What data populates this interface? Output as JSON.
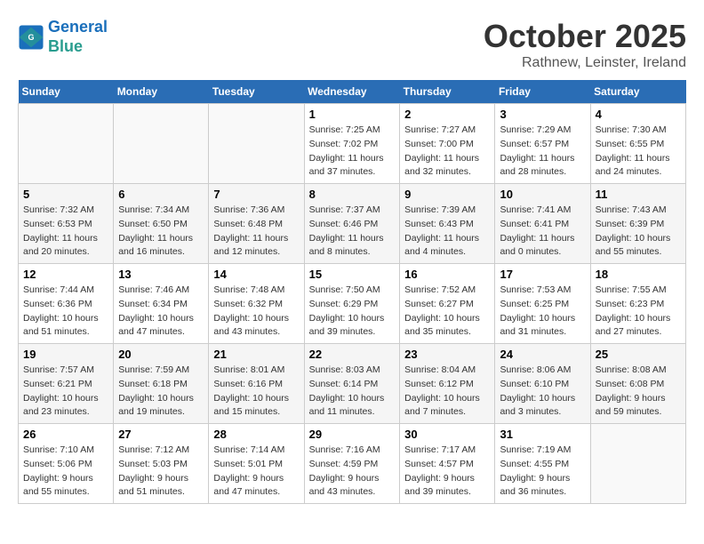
{
  "logo": {
    "line1": "General",
    "line2": "Blue"
  },
  "title": "October 2025",
  "subtitle": "Rathnew, Leinster, Ireland",
  "days_of_week": [
    "Sunday",
    "Monday",
    "Tuesday",
    "Wednesday",
    "Thursday",
    "Friday",
    "Saturday"
  ],
  "weeks": [
    [
      {
        "day": "",
        "sunrise": "",
        "sunset": "",
        "daylight": ""
      },
      {
        "day": "",
        "sunrise": "",
        "sunset": "",
        "daylight": ""
      },
      {
        "day": "",
        "sunrise": "",
        "sunset": "",
        "daylight": ""
      },
      {
        "day": "1",
        "sunrise": "Sunrise: 7:25 AM",
        "sunset": "Sunset: 7:02 PM",
        "daylight": "Daylight: 11 hours and 37 minutes."
      },
      {
        "day": "2",
        "sunrise": "Sunrise: 7:27 AM",
        "sunset": "Sunset: 7:00 PM",
        "daylight": "Daylight: 11 hours and 32 minutes."
      },
      {
        "day": "3",
        "sunrise": "Sunrise: 7:29 AM",
        "sunset": "Sunset: 6:57 PM",
        "daylight": "Daylight: 11 hours and 28 minutes."
      },
      {
        "day": "4",
        "sunrise": "Sunrise: 7:30 AM",
        "sunset": "Sunset: 6:55 PM",
        "daylight": "Daylight: 11 hours and 24 minutes."
      }
    ],
    [
      {
        "day": "5",
        "sunrise": "Sunrise: 7:32 AM",
        "sunset": "Sunset: 6:53 PM",
        "daylight": "Daylight: 11 hours and 20 minutes."
      },
      {
        "day": "6",
        "sunrise": "Sunrise: 7:34 AM",
        "sunset": "Sunset: 6:50 PM",
        "daylight": "Daylight: 11 hours and 16 minutes."
      },
      {
        "day": "7",
        "sunrise": "Sunrise: 7:36 AM",
        "sunset": "Sunset: 6:48 PM",
        "daylight": "Daylight: 11 hours and 12 minutes."
      },
      {
        "day": "8",
        "sunrise": "Sunrise: 7:37 AM",
        "sunset": "Sunset: 6:46 PM",
        "daylight": "Daylight: 11 hours and 8 minutes."
      },
      {
        "day": "9",
        "sunrise": "Sunrise: 7:39 AM",
        "sunset": "Sunset: 6:43 PM",
        "daylight": "Daylight: 11 hours and 4 minutes."
      },
      {
        "day": "10",
        "sunrise": "Sunrise: 7:41 AM",
        "sunset": "Sunset: 6:41 PM",
        "daylight": "Daylight: 11 hours and 0 minutes."
      },
      {
        "day": "11",
        "sunrise": "Sunrise: 7:43 AM",
        "sunset": "Sunset: 6:39 PM",
        "daylight": "Daylight: 10 hours and 55 minutes."
      }
    ],
    [
      {
        "day": "12",
        "sunrise": "Sunrise: 7:44 AM",
        "sunset": "Sunset: 6:36 PM",
        "daylight": "Daylight: 10 hours and 51 minutes."
      },
      {
        "day": "13",
        "sunrise": "Sunrise: 7:46 AM",
        "sunset": "Sunset: 6:34 PM",
        "daylight": "Daylight: 10 hours and 47 minutes."
      },
      {
        "day": "14",
        "sunrise": "Sunrise: 7:48 AM",
        "sunset": "Sunset: 6:32 PM",
        "daylight": "Daylight: 10 hours and 43 minutes."
      },
      {
        "day": "15",
        "sunrise": "Sunrise: 7:50 AM",
        "sunset": "Sunset: 6:29 PM",
        "daylight": "Daylight: 10 hours and 39 minutes."
      },
      {
        "day": "16",
        "sunrise": "Sunrise: 7:52 AM",
        "sunset": "Sunset: 6:27 PM",
        "daylight": "Daylight: 10 hours and 35 minutes."
      },
      {
        "day": "17",
        "sunrise": "Sunrise: 7:53 AM",
        "sunset": "Sunset: 6:25 PM",
        "daylight": "Daylight: 10 hours and 31 minutes."
      },
      {
        "day": "18",
        "sunrise": "Sunrise: 7:55 AM",
        "sunset": "Sunset: 6:23 PM",
        "daylight": "Daylight: 10 hours and 27 minutes."
      }
    ],
    [
      {
        "day": "19",
        "sunrise": "Sunrise: 7:57 AM",
        "sunset": "Sunset: 6:21 PM",
        "daylight": "Daylight: 10 hours and 23 minutes."
      },
      {
        "day": "20",
        "sunrise": "Sunrise: 7:59 AM",
        "sunset": "Sunset: 6:18 PM",
        "daylight": "Daylight: 10 hours and 19 minutes."
      },
      {
        "day": "21",
        "sunrise": "Sunrise: 8:01 AM",
        "sunset": "Sunset: 6:16 PM",
        "daylight": "Daylight: 10 hours and 15 minutes."
      },
      {
        "day": "22",
        "sunrise": "Sunrise: 8:03 AM",
        "sunset": "Sunset: 6:14 PM",
        "daylight": "Daylight: 10 hours and 11 minutes."
      },
      {
        "day": "23",
        "sunrise": "Sunrise: 8:04 AM",
        "sunset": "Sunset: 6:12 PM",
        "daylight": "Daylight: 10 hours and 7 minutes."
      },
      {
        "day": "24",
        "sunrise": "Sunrise: 8:06 AM",
        "sunset": "Sunset: 6:10 PM",
        "daylight": "Daylight: 10 hours and 3 minutes."
      },
      {
        "day": "25",
        "sunrise": "Sunrise: 8:08 AM",
        "sunset": "Sunset: 6:08 PM",
        "daylight": "Daylight: 9 hours and 59 minutes."
      }
    ],
    [
      {
        "day": "26",
        "sunrise": "Sunrise: 7:10 AM",
        "sunset": "Sunset: 5:06 PM",
        "daylight": "Daylight: 9 hours and 55 minutes."
      },
      {
        "day": "27",
        "sunrise": "Sunrise: 7:12 AM",
        "sunset": "Sunset: 5:03 PM",
        "daylight": "Daylight: 9 hours and 51 minutes."
      },
      {
        "day": "28",
        "sunrise": "Sunrise: 7:14 AM",
        "sunset": "Sunset: 5:01 PM",
        "daylight": "Daylight: 9 hours and 47 minutes."
      },
      {
        "day": "29",
        "sunrise": "Sunrise: 7:16 AM",
        "sunset": "Sunset: 4:59 PM",
        "daylight": "Daylight: 9 hours and 43 minutes."
      },
      {
        "day": "30",
        "sunrise": "Sunrise: 7:17 AM",
        "sunset": "Sunset: 4:57 PM",
        "daylight": "Daylight: 9 hours and 39 minutes."
      },
      {
        "day": "31",
        "sunrise": "Sunrise: 7:19 AM",
        "sunset": "Sunset: 4:55 PM",
        "daylight": "Daylight: 9 hours and 36 minutes."
      },
      {
        "day": "",
        "sunrise": "",
        "sunset": "",
        "daylight": ""
      }
    ]
  ]
}
